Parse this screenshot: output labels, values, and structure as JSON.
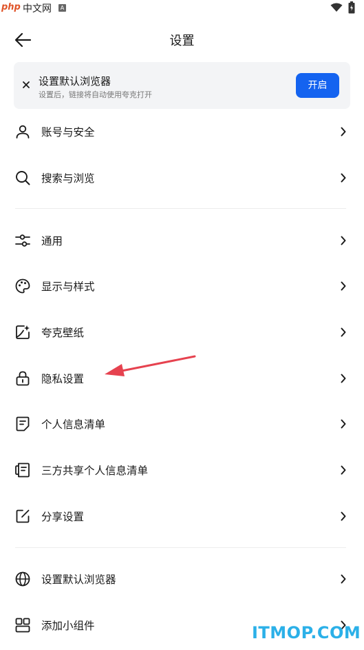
{
  "status_bar": {
    "watermark_php": "php",
    "watermark_cn": "中文网",
    "a_badge": "A"
  },
  "header": {
    "title": "设置"
  },
  "banner": {
    "title": "设置默认浏览器",
    "subtitle": "设置后，链接将自动使用夸克打开",
    "button_label": "开启",
    "button_color": "#1463f0"
  },
  "menu": [
    {
      "label": "账号与安全",
      "icon": "user-icon"
    },
    {
      "label": "搜索与浏览",
      "icon": "search-icon"
    },
    {
      "label": "通用",
      "icon": "sliders-icon"
    },
    {
      "label": "显示与样式",
      "icon": "palette-icon"
    },
    {
      "label": "夸克壁纸",
      "icon": "wallpaper-icon"
    },
    {
      "label": "隐私设置",
      "icon": "lock-icon"
    },
    {
      "label": "个人信息清单",
      "icon": "document-icon"
    },
    {
      "label": "三方共享个人信息清单",
      "icon": "share-list-icon"
    },
    {
      "label": "分享设置",
      "icon": "edit-square-icon"
    },
    {
      "label": "设置默认浏览器",
      "icon": "globe-icon"
    },
    {
      "label": "添加小组件",
      "icon": "widgets-icon"
    }
  ],
  "watermark_bottom": "ITMOP.COM",
  "annotation_arrow_color": "#e6424f"
}
